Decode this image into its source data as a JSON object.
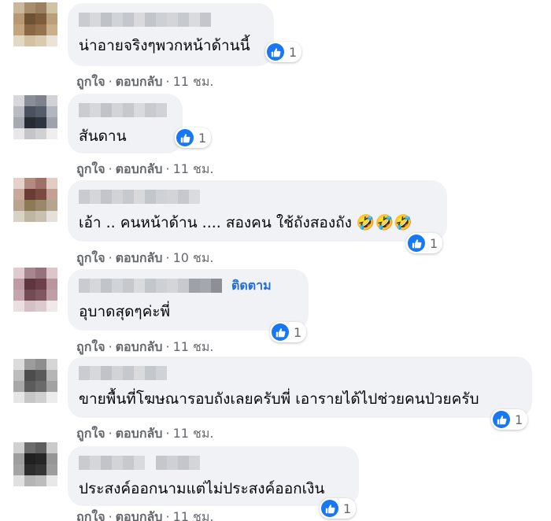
{
  "comments": [
    {
      "text": "น่าอายจริงๆพวกหน้าด้านนี้",
      "likes": "1",
      "like_label": "ถูกใจ",
      "reply_label": "ตอบกลับ",
      "time": "11 ชม."
    },
    {
      "text": "สันดาน",
      "likes": "1",
      "like_label": "ถูกใจ",
      "reply_label": "ตอบกลับ",
      "time": "11 ชม."
    },
    {
      "text": "เอ้า .. คนหน้าด้าน .... สองคน ใช้ถังสองถัง 🤣🤣🤣",
      "likes": "1",
      "like_label": "ถูกใจ",
      "reply_label": "ตอบกลับ",
      "time": "10 ชม."
    },
    {
      "text": "อุบาดสุดๆค่ะพี่",
      "follow": "ติดตาม",
      "likes": "1",
      "like_label": "ถูกใจ",
      "reply_label": "ตอบกลับ",
      "time": "11 ชม."
    },
    {
      "text": "ขายพื้นที่โฆษณารอบถังเลยครับพี่ เอารายได้ไปช่วยคนป่วยครับ",
      "likes": "1",
      "like_label": "ถูกใจ",
      "reply_label": "ตอบกลับ",
      "time": "11 ชม."
    },
    {
      "text": "ประสงค์ออกนามแต่ไม่ประสงค์ออกเงิน",
      "likes": "1",
      "like_label": "ถูกใจ",
      "reply_label": "ตอบกลับ",
      "time": "11 ชม."
    }
  ],
  "separator": "·",
  "colors": {
    "like_blue": "#1877f2",
    "bubble_bg": "#f0f2f5",
    "follow_blue": "#216fdb",
    "meta_gray": "#65676b"
  },
  "icons": {
    "reaction": "like-thumbs-up-icon",
    "avatar": "pixelated-avatar"
  }
}
